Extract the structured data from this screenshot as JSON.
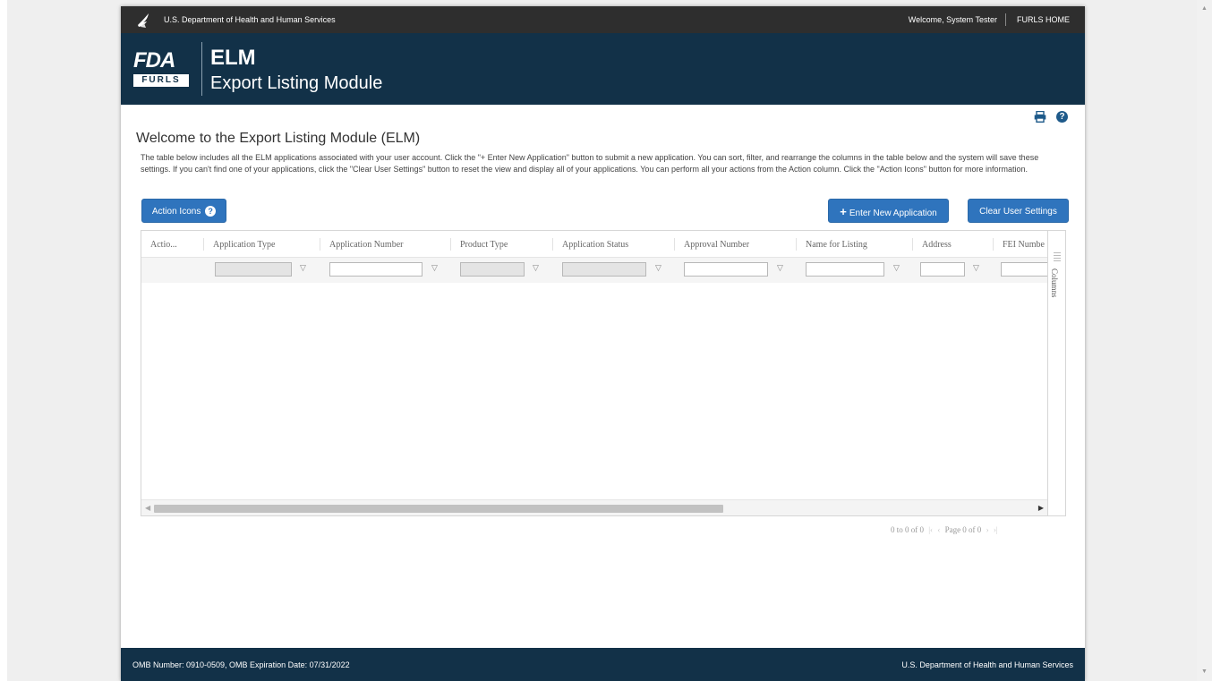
{
  "topbar": {
    "agency": "U.S. Department of Health and Human Services",
    "welcome": "Welcome, System Tester",
    "home_link": "FURLS HOME"
  },
  "header": {
    "logo_text": "FDA",
    "badge_text": "FURLS",
    "app_short": "ELM",
    "app_long": "Export Listing Module"
  },
  "main": {
    "title": "Welcome to the Export Listing Module (ELM)",
    "intro": "The table below includes all the ELM applications associated with your user account. Click the \"+ Enter New Application\" button to submit a new application. You can sort, filter, and rearrange the columns in the table below and the system will save these settings. If you can't find one of your applications, click the \"Clear User Settings\" button to reset the view and display all of your applications. You can perform all your actions from the Action column. Click the \"Action Icons\" button for more information.",
    "help_icon": "?"
  },
  "buttons": {
    "action_icons": "Action Icons",
    "action_icons_badge": "?",
    "enter_new_plus": "+",
    "enter_new": "Enter New Application",
    "clear_settings": "Clear User Settings"
  },
  "grid": {
    "columns": [
      "Actio...",
      "Application Type",
      "Application Number",
      "Product Type",
      "Application Status",
      "Approval Number",
      "Name for Listing",
      "Address",
      "FEI Numbe"
    ],
    "side_label": "Columns",
    "filter_glyph": "▽"
  },
  "pager": {
    "range": "0 to 0 of 0",
    "page": "Page 0 of 0",
    "first": "|‹",
    "prev": "‹",
    "next": "›",
    "last": "›|"
  },
  "footer": {
    "omb": "OMB Number: 0910-0509, OMB Expiration Date: 07/31/2022",
    "agency": "U.S. Department of Health and Human Services"
  },
  "colors": {
    "header_bg": "#123148",
    "topbar_bg": "#2e2e2e",
    "button_bg": "#2f74bd"
  }
}
